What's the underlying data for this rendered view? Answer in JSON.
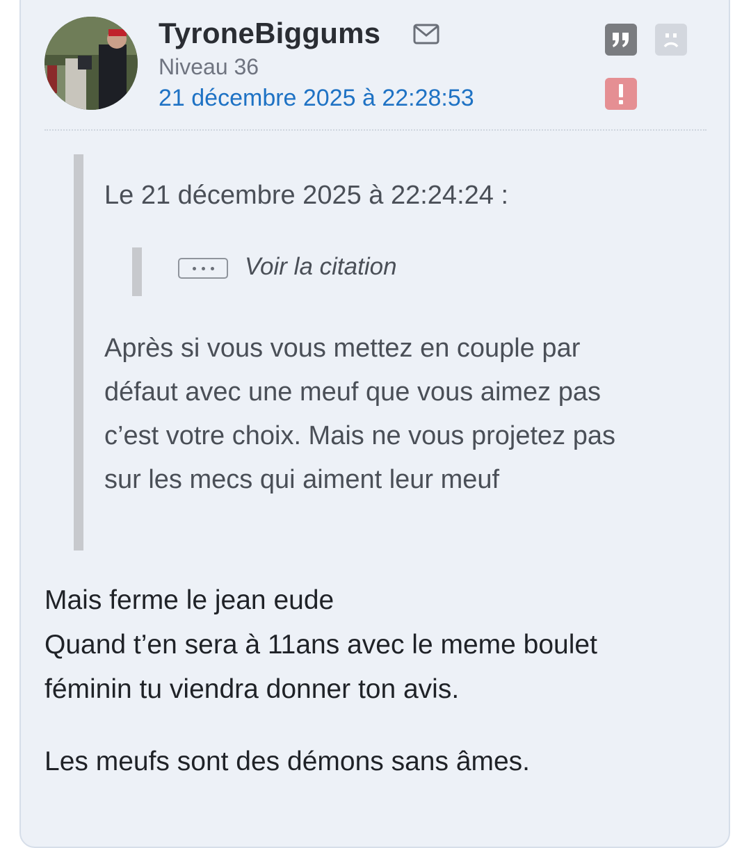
{
  "post": {
    "author": "TyroneBiggums",
    "level": "Niveau 36",
    "date": "21 décembre 2025 à 22:28:53",
    "icons": {
      "mail": "mail-icon",
      "quote": "quote-icon",
      "sad": "sad-face-icon",
      "alert": "alert-icon"
    },
    "colors": {
      "card_background": "#edf1f7",
      "date_link": "#1e72c4",
      "quote_button": "#7a7c80",
      "alert_button": "#e58f93"
    }
  },
  "quote": {
    "header": "Le 21 décembre 2025 à 22:24:24 :",
    "nested_label": "Voir la citation",
    "lines": [
      "Après si vous vous mettez en couple par",
      "défaut avec une meuf que vous aimez pas",
      "c’est votre choix. Mais ne vous projetez pas",
      "sur les mecs qui aiment leur meuf"
    ]
  },
  "message": {
    "lines": [
      "Mais ferme le jean eude",
      "Quand t’en sera à 11ans avec le meme boulet",
      "féminin tu viendra donner ton avis."
    ],
    "closing": "Les meufs sont des démons sans âmes."
  }
}
